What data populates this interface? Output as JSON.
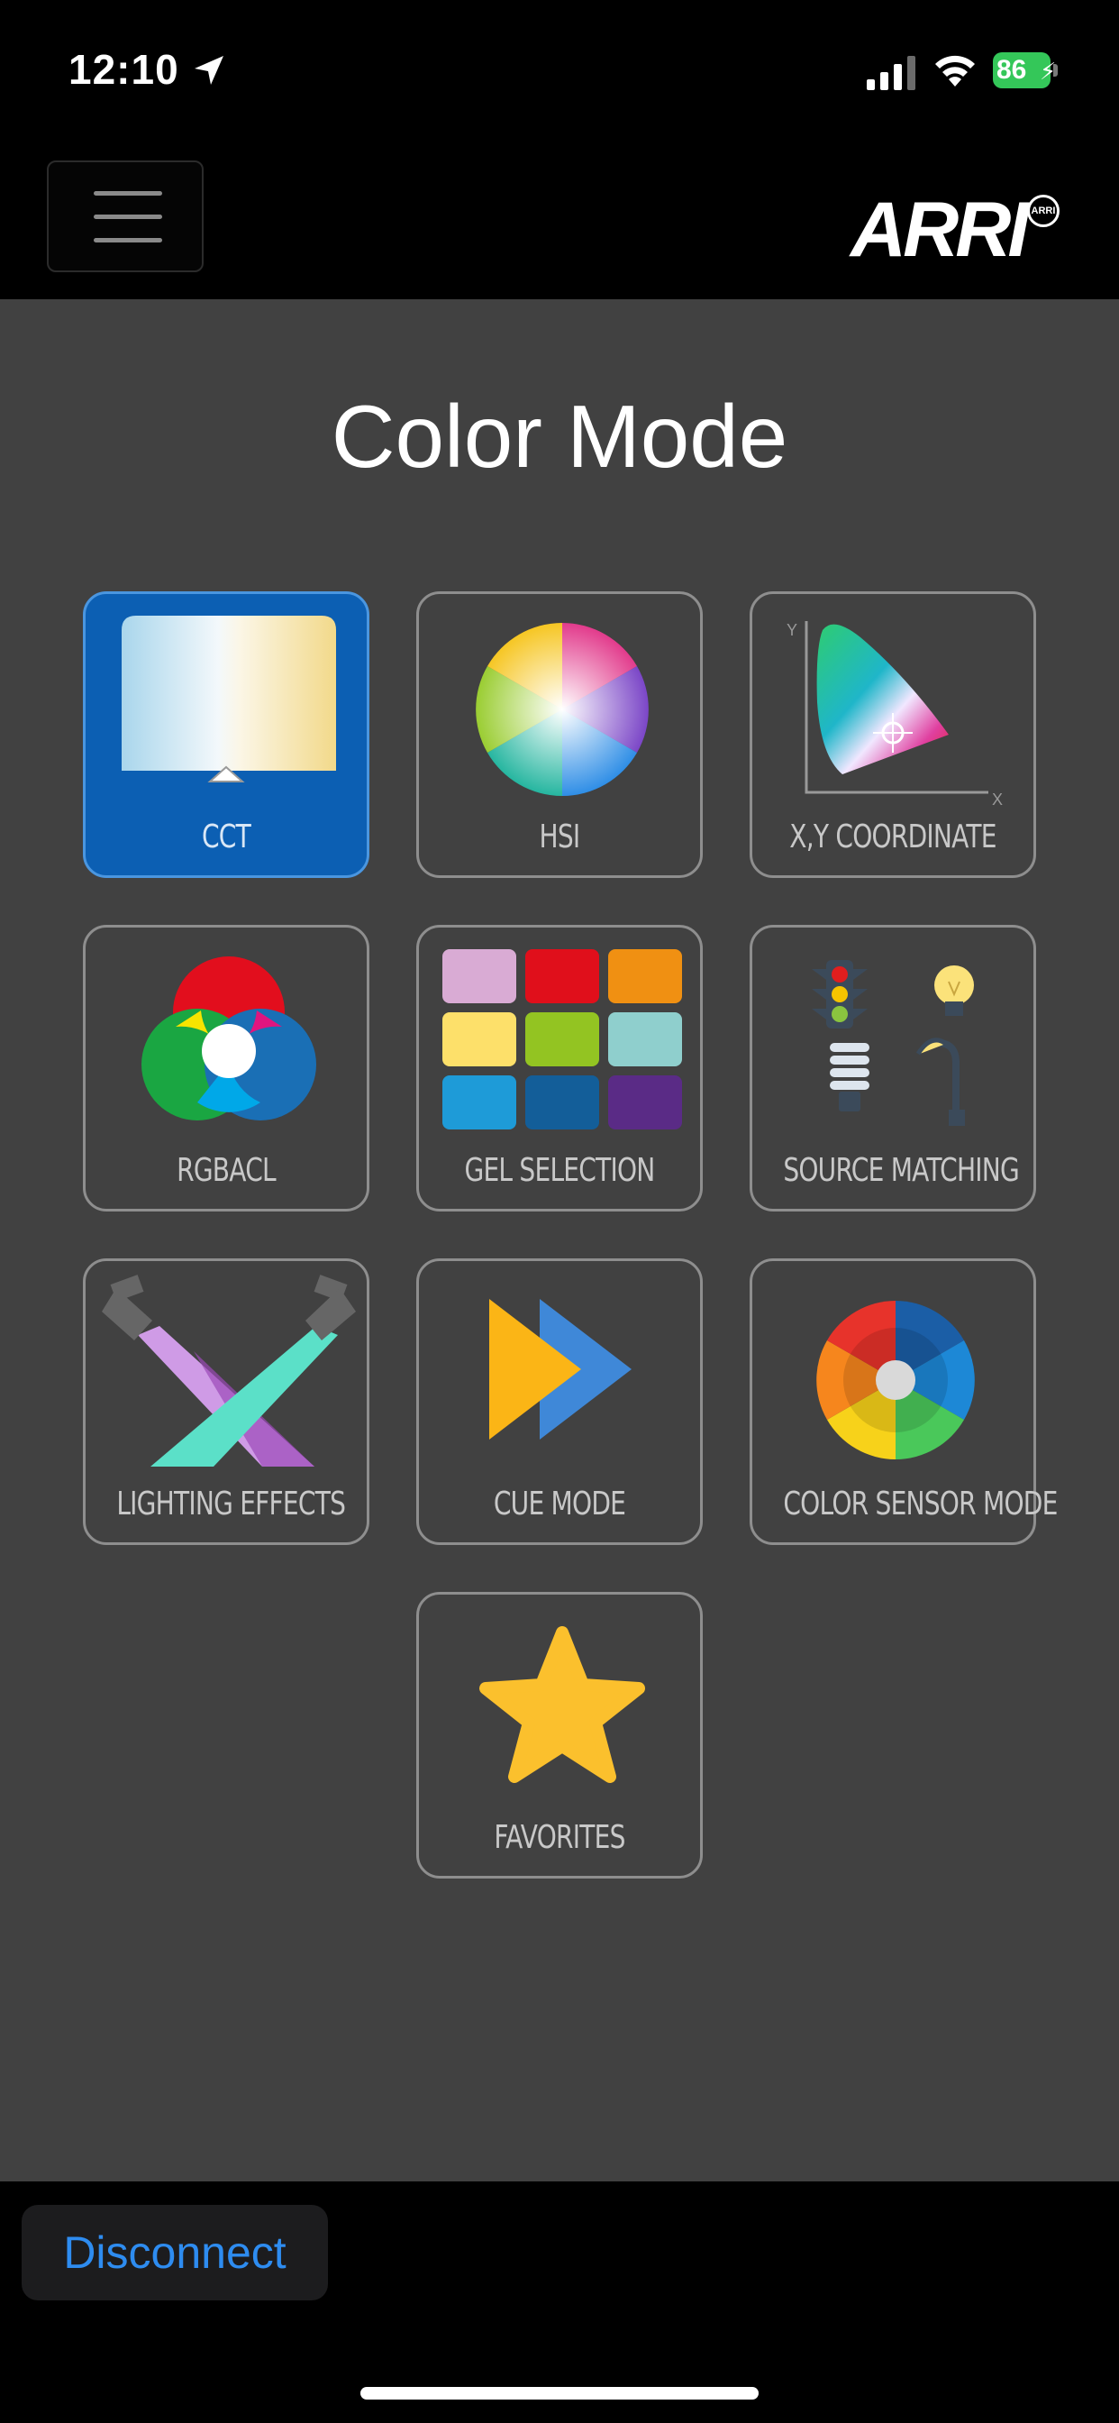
{
  "status_bar": {
    "time": "12:10",
    "battery": "86"
  },
  "nav": {
    "logo_text": "ARRI",
    "logo_seal": "ARRI"
  },
  "page": {
    "title": "Color Mode"
  },
  "tiles": [
    {
      "label": "CCT",
      "icon": "cct-icon",
      "selected": true
    },
    {
      "label": "HSI",
      "icon": "hsi-icon"
    },
    {
      "label": "X,Y COORDINATE",
      "icon": "xy-coordinate-icon"
    },
    {
      "label": "RGBACL",
      "icon": "rgbacl-icon"
    },
    {
      "label": "GEL SELECTION",
      "icon": "gel-selection-icon"
    },
    {
      "label": "SOURCE MATCHING",
      "icon": "source-matching-icon"
    },
    {
      "label": "LIGHTING EFFECTS",
      "icon": "lighting-effects-icon"
    },
    {
      "label": "CUE MODE",
      "icon": "cue-mode-icon"
    },
    {
      "label": "COLOR SENSOR MODE",
      "icon": "color-sensor-icon"
    },
    {
      "label": "FAVORITES",
      "icon": "star-icon"
    }
  ],
  "bottom": {
    "disconnect_label": "Disconnect"
  },
  "colors": {
    "accent": "#2e8cf0",
    "selected_tile": "#0c5fb3",
    "background": "#414141"
  }
}
